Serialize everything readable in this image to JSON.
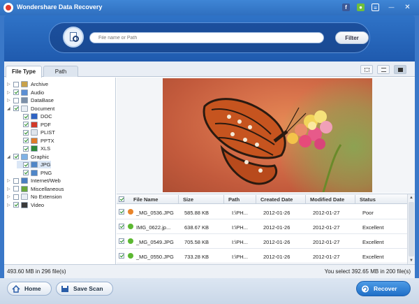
{
  "window": {
    "title": "Wondershare Data Recovery"
  },
  "titlebar_icons": [
    "facebook-icon",
    "chat-icon",
    "menu-icon",
    "minimize-icon",
    "close-icon"
  ],
  "search": {
    "placeholder": "File name or Path",
    "filter_label": "Filter"
  },
  "tabs": [
    {
      "label": "File Type",
      "active": true
    },
    {
      "label": "Path",
      "active": false
    }
  ],
  "tree": [
    {
      "label": "Archive",
      "level": 0,
      "expander": "▷",
      "checked": false,
      "icon_color": "#c9a24b"
    },
    {
      "label": "Audio",
      "level": 0,
      "expander": "▷",
      "checked": true,
      "icon_color": "#5b8fd4"
    },
    {
      "label": "DataBase",
      "level": 0,
      "expander": "▷",
      "checked": false,
      "icon_color": "#7b8fa8"
    },
    {
      "label": "Document",
      "level": 0,
      "expander": "◢",
      "checked": true,
      "icon_color": "#e9eef4"
    },
    {
      "label": "DOC",
      "level": 1,
      "expander": "",
      "checked": true,
      "icon_color": "#2f64c4"
    },
    {
      "label": "PDF",
      "level": 1,
      "expander": "",
      "checked": true,
      "icon_color": "#d23a2a"
    },
    {
      "label": "PLIST",
      "level": 1,
      "expander": "",
      "checked": true,
      "icon_color": "#dfe5ec"
    },
    {
      "label": "PPTX",
      "level": 1,
      "expander": "",
      "checked": true,
      "icon_color": "#e07b2b"
    },
    {
      "label": "XLS",
      "level": 1,
      "expander": "",
      "checked": true,
      "icon_color": "#2f8a3a"
    },
    {
      "label": "Graphic",
      "level": 0,
      "expander": "◢",
      "checked": true,
      "icon_color": "#7fb2e5"
    },
    {
      "label": "JPG",
      "level": 1,
      "expander": "",
      "checked": true,
      "icon_color": "#4f86c8",
      "selected": true
    },
    {
      "label": "PNG",
      "level": 1,
      "expander": "",
      "checked": true,
      "icon_color": "#4f86c8"
    },
    {
      "label": "Internet/Web",
      "level": 0,
      "expander": "▷",
      "checked": false,
      "icon_color": "#4a7fc2"
    },
    {
      "label": "Miscellaneous",
      "level": 0,
      "expander": "▷",
      "checked": false,
      "icon_color": "#6aa83c"
    },
    {
      "label": "No Extension",
      "level": 0,
      "expander": "▷",
      "checked": false,
      "icon_color": "#e9eef4"
    },
    {
      "label": "Video",
      "level": 0,
      "expander": "▷",
      "checked": true,
      "icon_color": "#3a3a3a"
    }
  ],
  "table": {
    "columns": [
      "File Name",
      "Size",
      "Path",
      "Created Date",
      "Modified Date",
      "Status"
    ],
    "rows": [
      {
        "name": "_MG_0536.JPG",
        "size": "585.88 KB",
        "path": "I:\\PH...",
        "created": "2012-01-26",
        "modified": "2012-01-27",
        "status": "Poor",
        "status_color": "#e8842a"
      },
      {
        "name": "IMG_0622.jp...",
        "size": "638.67 KB",
        "path": "I:\\PH...",
        "created": "2012-01-26",
        "modified": "2012-01-27",
        "status": "Excellent",
        "status_color": "#5cb832"
      },
      {
        "name": "_MG_0549.JPG",
        "size": "705.58 KB",
        "path": "I:\\PH...",
        "created": "2012-01-26",
        "modified": "2012-01-27",
        "status": "Excellent",
        "status_color": "#5cb832"
      },
      {
        "name": "_MG_0550.JPG",
        "size": "733.28 KB",
        "path": "I:\\PH...",
        "created": "2012-01-26",
        "modified": "2012-01-27",
        "status": "Excellent",
        "status_color": "#5cb832"
      }
    ]
  },
  "status": {
    "left": "493.60 MB in 296 file(s)",
    "right": "You select 392.65 MB in 200 file(s)"
  },
  "footer": {
    "home_label": "Home",
    "save_scan_label": "Save Scan",
    "recover_label": "Recover"
  },
  "colors": {
    "brand_blue": "#2f6fc0",
    "poor": "#e8842a",
    "excellent": "#5cb832"
  }
}
